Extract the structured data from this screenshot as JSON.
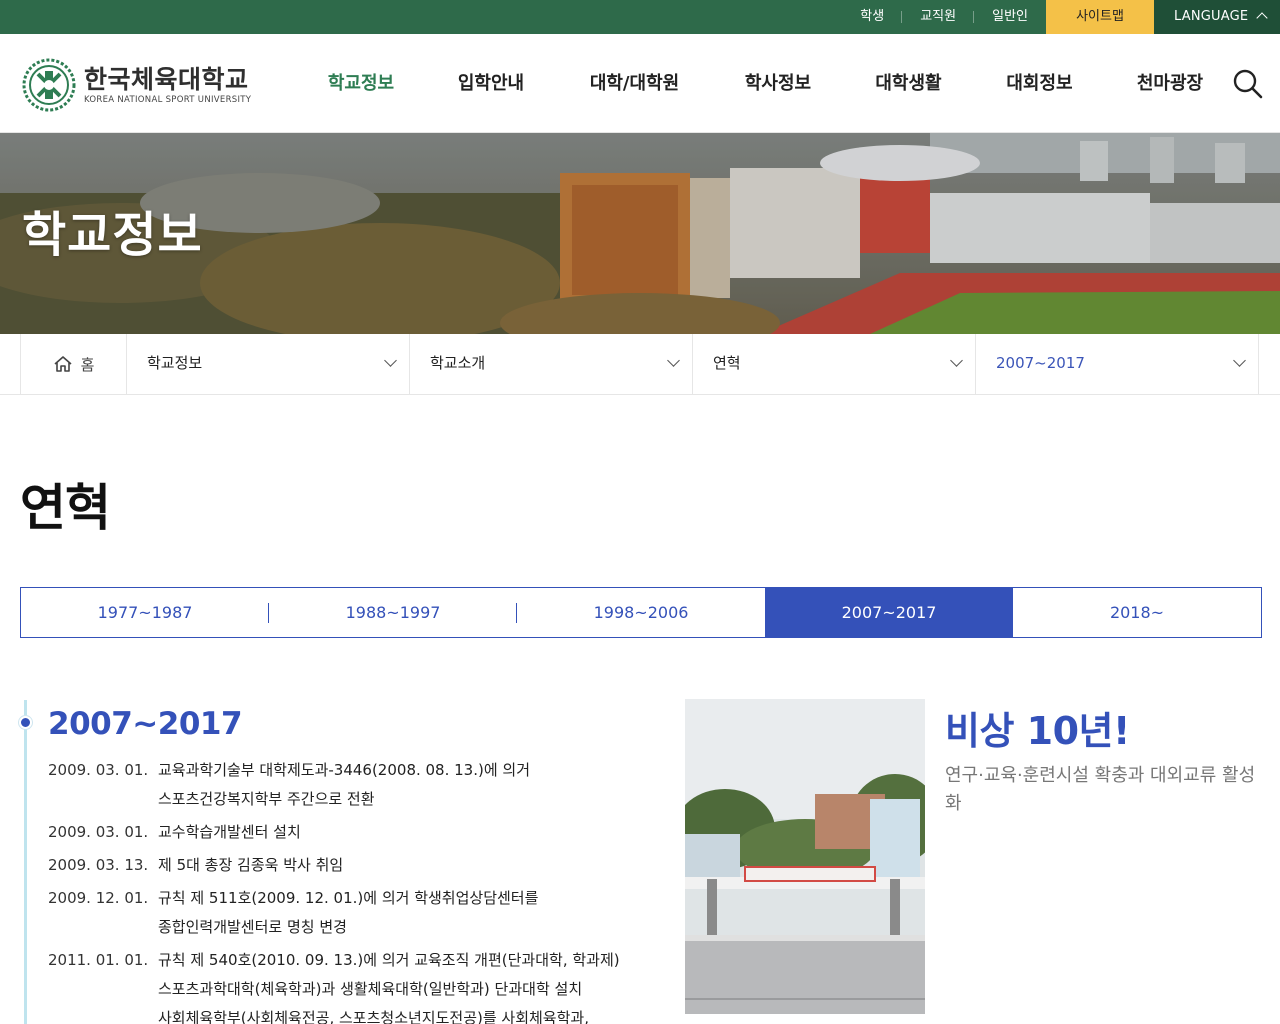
{
  "util_links": [
    {
      "label": "학생"
    },
    {
      "label": "교직원"
    },
    {
      "label": "일반인"
    }
  ],
  "sitemap_label": "사이트맵",
  "language_label": "LANGUAGE",
  "logo": {
    "kor": "한국체육대학교",
    "eng": "KOREA NATIONAL SPORT UNIVERSITY"
  },
  "gnb": [
    "학교정보",
    "입학안내",
    "대학/대학원",
    "학사정보",
    "대학생활",
    "대회정보",
    "천마광장"
  ],
  "banner_title": "학교정보",
  "location": {
    "home": "홈",
    "depth1": "학교정보",
    "depth2": "학교소개",
    "depth3": "연혁",
    "depth4": "2007~2017"
  },
  "page_title": "연혁",
  "tabs": [
    "1977~1987",
    "1988~1997",
    "1998~2006",
    "2007~2017",
    "2018~"
  ],
  "active_tab": "2007~2017",
  "era_title": "2007~2017",
  "events": [
    {
      "date": "2009. 03. 01.",
      "lines": [
        "교육과학기술부 대학제도과-3446(2008. 08. 13.)에 의거",
        "스포츠건강복지학부 주간으로 전환"
      ]
    },
    {
      "date": "2009. 03. 01.",
      "lines": [
        "교수학습개발센터 설치"
      ]
    },
    {
      "date": "2009. 03. 13.",
      "lines": [
        "제 5대 총장 김종욱 박사 취임"
      ]
    },
    {
      "date": "2009. 12. 01.",
      "lines": [
        "규칙 제 511호(2009. 12. 01.)에 의거 학생취업상담센터를",
        "종합인력개발센터로 명칭 변경"
      ]
    },
    {
      "date": "2011. 01. 01.",
      "lines": [
        "규칙 제 540호(2010. 09. 13.)에 의거 교육조직 개편(단과대학, 학과제)",
        "스포츠과학대학(체육학과)과 생활체육대학(일반학과) 단과대학 설치",
        "사회체육학부(사회체육전공, 스포츠청소년지도전공)를 사회체육학과,"
      ]
    }
  ],
  "slogan": "비상 10년!",
  "slogan_sub": "연구·교육·훈련시설 확충과 대외교류 활성화",
  "colors": {
    "brand_green": "#2e6a4a",
    "accent_yellow": "#f4c148",
    "accent_blue": "#3451b9",
    "gnb_active": "#2e7d53"
  }
}
